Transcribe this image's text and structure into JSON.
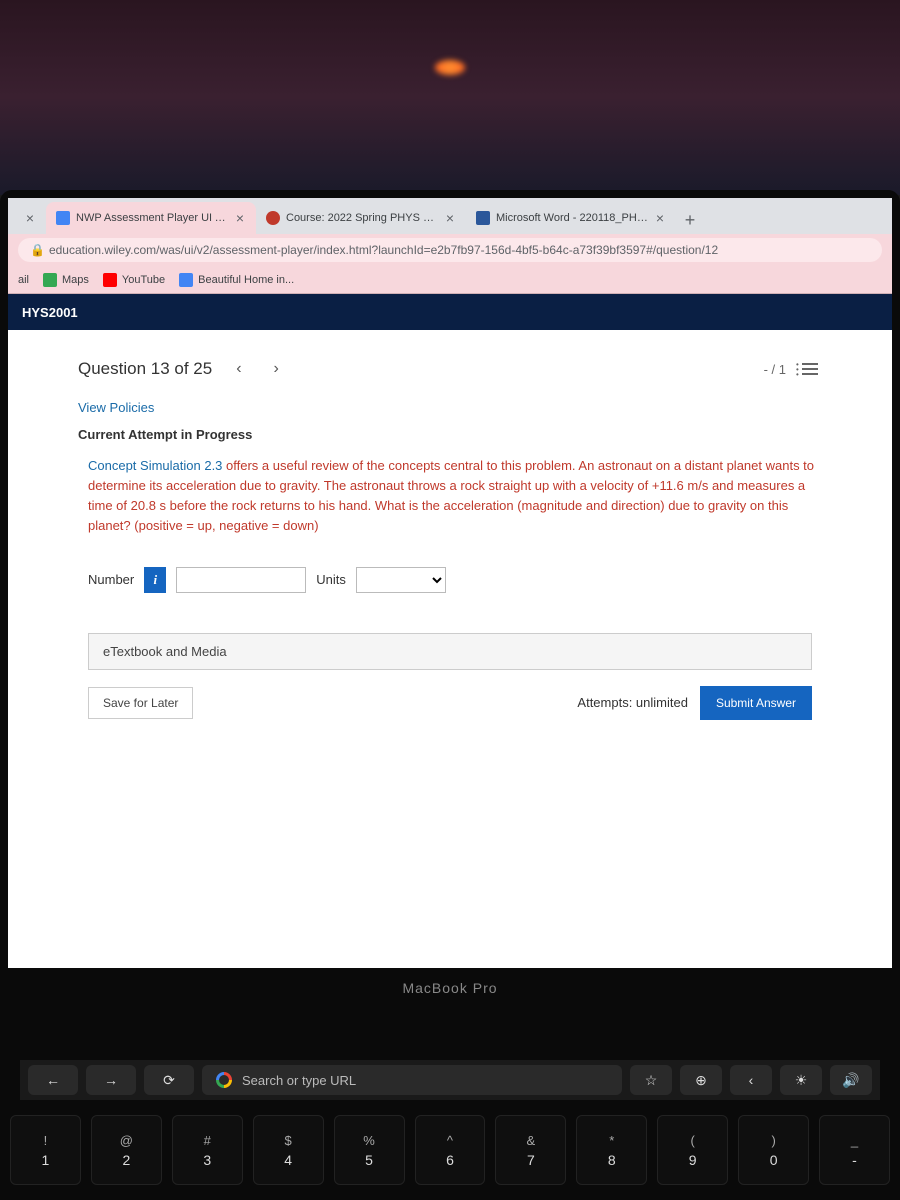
{
  "tabs": [
    {
      "title": "",
      "close": "×"
    },
    {
      "title": "NWP Assessment Player UI App",
      "close": "×"
    },
    {
      "title": "Course: 2022 Spring PHYS 200",
      "close": "×"
    },
    {
      "title": "Microsoft Word - 220118_PHYS",
      "close": "×"
    }
  ],
  "url": "education.wiley.com/was/ui/v2/assessment-player/index.html?launchId=e2b7fb97-156d-4bf5-b64c-a73f39bf3597#/question/12",
  "bookmarks": {
    "gmail": "ail",
    "maps": "Maps",
    "youtube": "YouTube",
    "home": "Beautiful Home in..."
  },
  "course_code": "HYS2001",
  "question": {
    "label": "Question 13 of 25",
    "score": "- / 1",
    "policies": "View Policies",
    "attempt_status": "Current Attempt in Progress",
    "sim_link": "Concept Simulation 2.3",
    "body": " offers a useful review of the concepts central to this problem. An astronaut on a distant planet wants to determine its acceleration due to gravity. The astronaut throws a rock straight up with a velocity of +11.6 m/s and measures a time of 20.8 s before the rock returns to his hand. What is the acceleration (magnitude and direction) due to gravity on this planet? (positive = up, negative = down)",
    "number_label": "Number",
    "units_label": "Units",
    "etextbook": "eTextbook and Media",
    "save": "Save for Later",
    "attempts": "Attempts: unlimited",
    "submit": "Submit Answer"
  },
  "touchbar": {
    "search": "Search or type URL"
  },
  "macbook": "MacBook Pro",
  "keys": [
    {
      "sym": "!",
      "num": "1"
    },
    {
      "sym": "@",
      "num": "2"
    },
    {
      "sym": "#",
      "num": "3"
    },
    {
      "sym": "$",
      "num": "4"
    },
    {
      "sym": "%",
      "num": "5"
    },
    {
      "sym": "^",
      "num": "6"
    },
    {
      "sym": "&",
      "num": "7"
    },
    {
      "sym": "*",
      "num": "8"
    },
    {
      "sym": "(",
      "num": "9"
    },
    {
      "sym": ")",
      "num": "0"
    },
    {
      "sym": "_",
      "num": "-"
    }
  ]
}
